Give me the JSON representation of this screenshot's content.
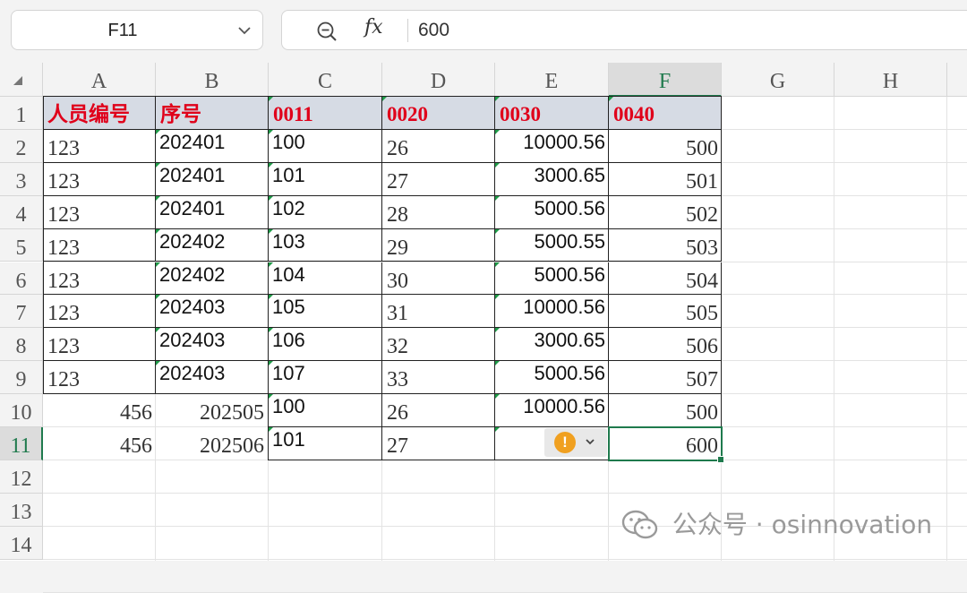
{
  "name_box": {
    "value": "F11"
  },
  "formula_bar": {
    "fx_label": "fx",
    "content": "600"
  },
  "columns": [
    "A",
    "B",
    "C",
    "D",
    "E",
    "F",
    "G",
    "H"
  ],
  "rows": [
    "1",
    "2",
    "3",
    "4",
    "5",
    "6",
    "7",
    "8",
    "9",
    "10",
    "11",
    "12",
    "13",
    "14"
  ],
  "header_row": [
    "人员编号",
    "序号",
    "0011",
    "0020",
    "0030",
    "0040"
  ],
  "data_rows": [
    [
      "123",
      "202401",
      "100",
      "26",
      "10000.56",
      "500"
    ],
    [
      "123",
      "202401",
      "101",
      "27",
      "3000.65",
      "501"
    ],
    [
      "123",
      "202401",
      "102",
      "28",
      "5000.56",
      "502"
    ],
    [
      "123",
      "202402",
      "103",
      "29",
      "5000.55",
      "503"
    ],
    [
      "123",
      "202402",
      "104",
      "30",
      "5000.56",
      "504"
    ],
    [
      "123",
      "202403",
      "105",
      "31",
      "10000.56",
      "505"
    ],
    [
      "123",
      "202403",
      "106",
      "32",
      "3000.65",
      "506"
    ],
    [
      "123",
      "202403",
      "107",
      "33",
      "5000.56",
      "507"
    ],
    [
      "456",
      "202505",
      "100",
      "26",
      "10000.56",
      "500"
    ],
    [
      "456",
      "202506",
      "101",
      "27",
      "",
      "600"
    ]
  ],
  "error_indicator": {
    "symbol": "!"
  },
  "watermark": {
    "text": "公众号 · osinnovation"
  }
}
